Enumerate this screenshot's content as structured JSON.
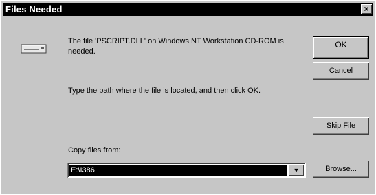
{
  "window": {
    "title": "Files Needed",
    "close_glyph": "×"
  },
  "message": {
    "line1": "The file 'PSCRIPT.DLL' on Windows NT Workstation CD-ROM is needed.",
    "line2": "Type the path where the file is located, and then click OK."
  },
  "copy_from": {
    "label": "Copy files from:",
    "value": "E:\\I386"
  },
  "buttons": {
    "ok": "OK",
    "cancel": "Cancel",
    "skip_file": "Skip File",
    "browse": "Browse..."
  },
  "icons": {
    "drive": "cd-drive-icon",
    "dropdown": "chevron-down-icon",
    "close": "close-icon"
  }
}
